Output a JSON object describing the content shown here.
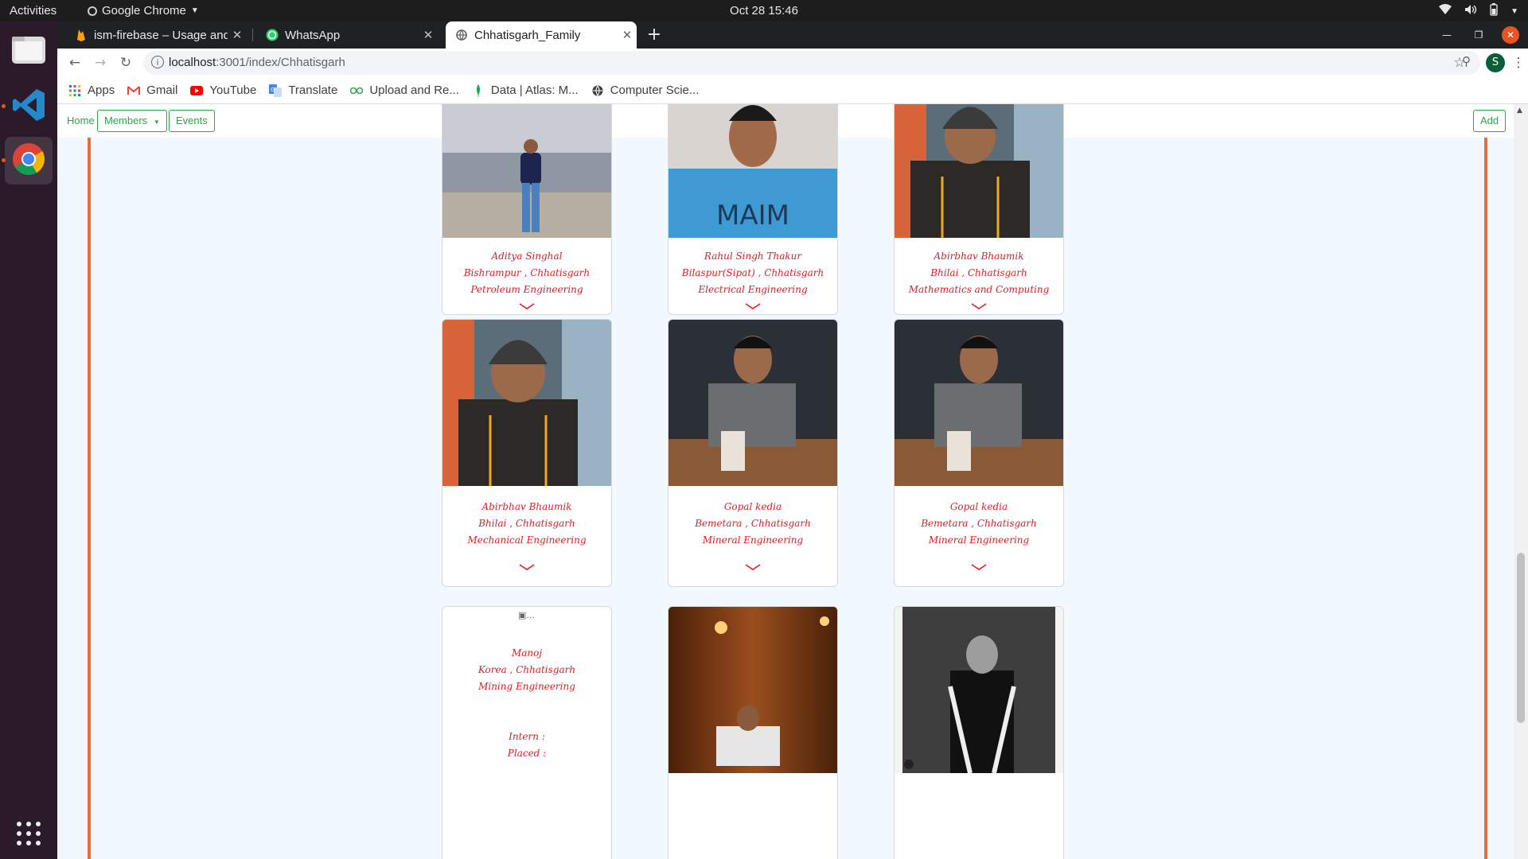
{
  "os": {
    "activities": "Activities",
    "app_name": "Google Chrome",
    "clock": "Oct 28  15:46"
  },
  "browser": {
    "tabs": [
      {
        "title": "ism-firebase – Usage and b",
        "icon": "firebase-icon"
      },
      {
        "title": "WhatsApp",
        "icon": "whatsapp-icon"
      },
      {
        "title": "Chhatisgarh_Family",
        "icon": "globe-icon",
        "active": true
      }
    ],
    "url_host": "localhost",
    "url_rest": ":3001/index/Chhatisgarh",
    "profile_initial": "S",
    "bookmarks": [
      {
        "label": "Apps",
        "icon": "apps-grid-icon"
      },
      {
        "label": "Gmail",
        "icon": "gmail-icon"
      },
      {
        "label": "YouTube",
        "icon": "youtube-icon"
      },
      {
        "label": "Translate",
        "icon": "translate-icon"
      },
      {
        "label": "Upload and Re...",
        "icon": "upload-icon"
      },
      {
        "label": "Data | Atlas: M...",
        "icon": "mongodb-leaf-icon"
      },
      {
        "label": "Computer Scie...",
        "icon": "globe-icon"
      }
    ]
  },
  "navbar": {
    "home": "Home",
    "members": "Members",
    "events": "Events",
    "add": "Add"
  },
  "members": [
    {
      "name": "Aditya Singhal",
      "place": "Bishrampur , Chhatisgarh",
      "branch": "Petroleum Engineering"
    },
    {
      "name": "Rahul Singh Thakur",
      "place": "Bilaspur(Sipat) , Chhatisgarh",
      "branch": "Electrical Engineering"
    },
    {
      "name": "Abirbhav Bhaumik",
      "place": "Bhilai , Chhatisgarh",
      "branch": "Mathematics and Computing"
    },
    {
      "name": "Abirbhav Bhaumik",
      "place": "Bhilai , Chhatisgarh",
      "branch": "Mechanical Engineering"
    },
    {
      "name": "Gopal kedia",
      "place": "Bemetara , Chhatisgarh",
      "branch": "Mineral Engineering"
    },
    {
      "name": "Gopal kedia",
      "place": "Bemetara , Chhatisgarh",
      "branch": "Mineral Engineering"
    },
    {
      "name": "Manoj",
      "place": "Korea , Chhatisgarh",
      "branch": "Mining Engineering",
      "intern": "Intern :",
      "placed": "Placed :",
      "broken_image_alt": "..."
    }
  ],
  "colors": {
    "accent_green": "#28a745",
    "card_text_red": "#e31b23",
    "border_orange": "#e2703a",
    "page_bg": "#f1f8ff"
  }
}
